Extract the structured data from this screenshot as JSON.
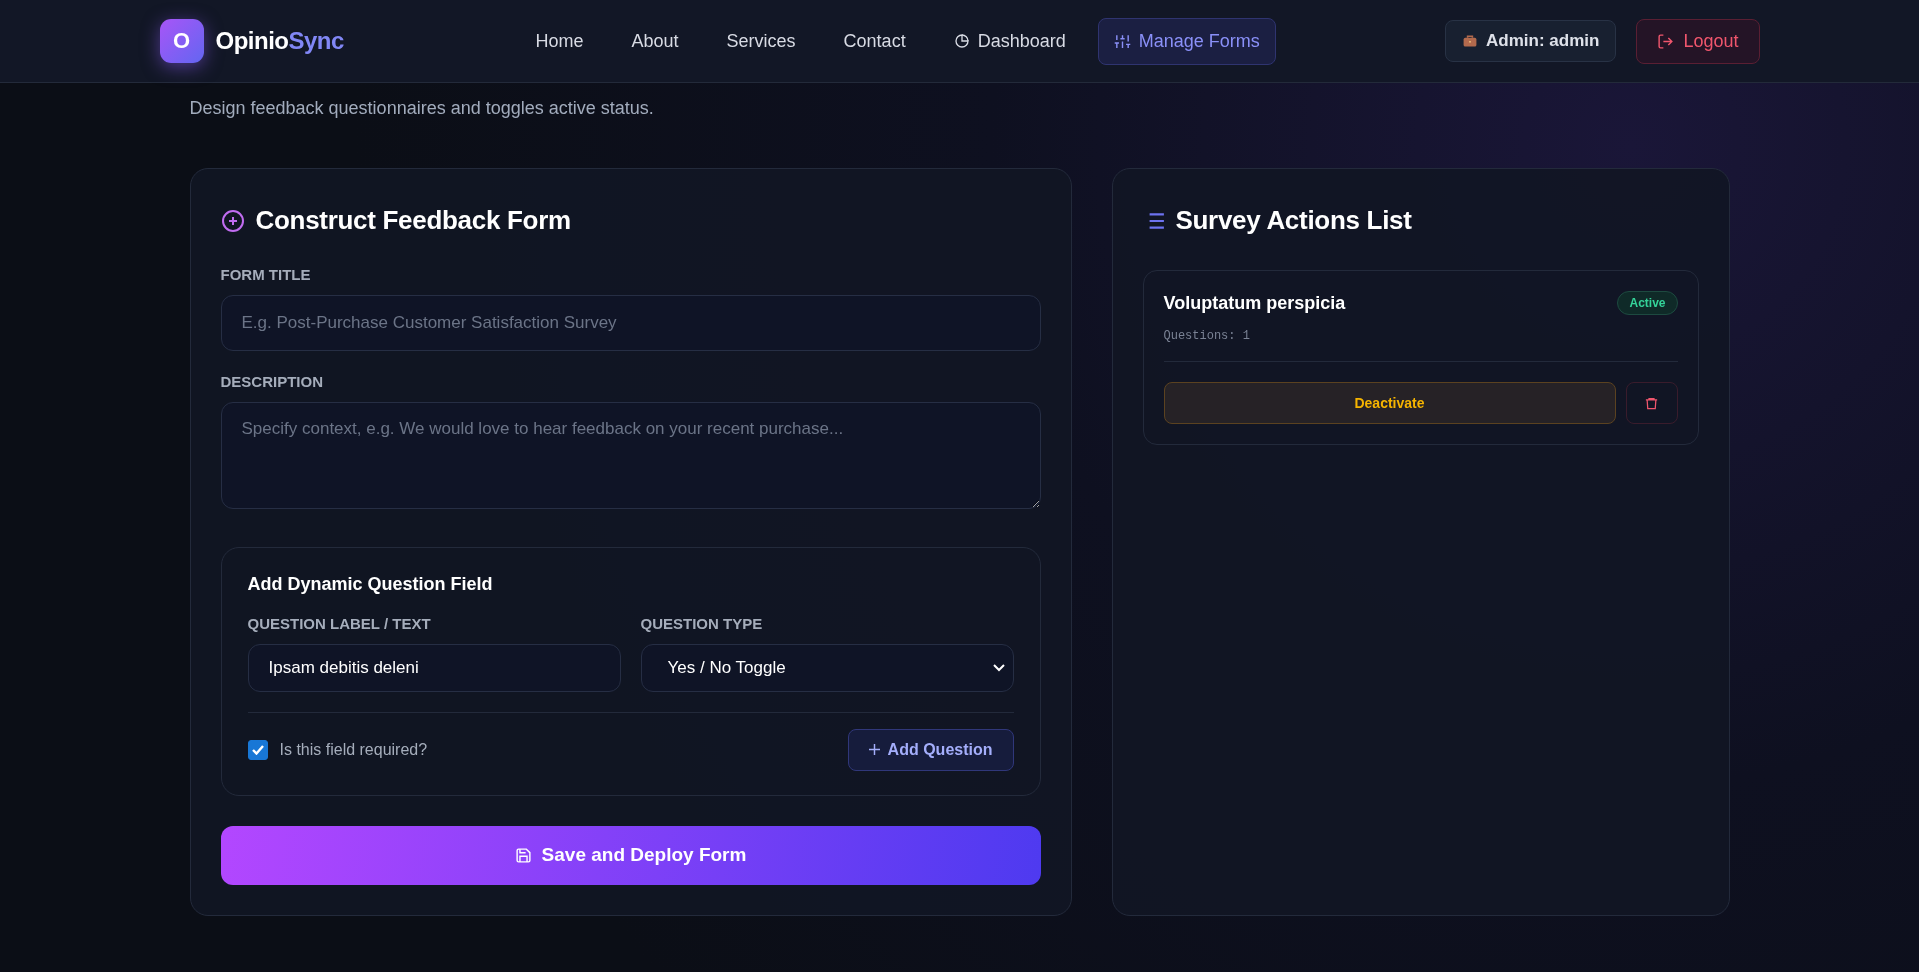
{
  "navbar": {
    "brand": {
      "first": "Opinio",
      "second": "Sync",
      "mark": "O"
    },
    "links": [
      {
        "label": "Home",
        "selected": false
      },
      {
        "label": "About",
        "selected": false
      },
      {
        "label": "Services",
        "selected": false
      },
      {
        "label": "Contact",
        "selected": false
      },
      {
        "label": "Dashboard",
        "selected": false
      },
      {
        "label": "Manage Forms",
        "selected": true
      }
    ],
    "user": "Admin: admin",
    "logout": "Logout"
  },
  "page": {
    "subtitle": "Design feedback questionnaires and toggles active status."
  },
  "builder": {
    "title": "Construct Feedback Form",
    "form_title": {
      "label": "FORM TITLE",
      "placeholder": "E.g. Post-Purchase Customer Satisfaction Survey"
    },
    "description": {
      "label": "DESCRIPTION",
      "placeholder": "Specify context, e.g. We would love to hear feedback on your recent purchase..."
    },
    "question": {
      "title": "Add Dynamic Question Field",
      "text": {
        "label": "QUESTION LABEL / TEXT",
        "value": "Ipsam debitis deleni"
      },
      "type": {
        "label": "QUESTION TYPE",
        "value": "Yes / No Toggle"
      },
      "required": {
        "label": "Is this field required?",
        "checked": true
      },
      "add": "Add Question"
    },
    "save": "Save and Deploy Form"
  },
  "surveys": {
    "title": "Survey Actions List",
    "items": [
      {
        "title": "Voluptatum perspicia",
        "questions": "Questions: 1",
        "status": "Active",
        "active": true,
        "toggle": "Deactivate"
      }
    ]
  }
}
